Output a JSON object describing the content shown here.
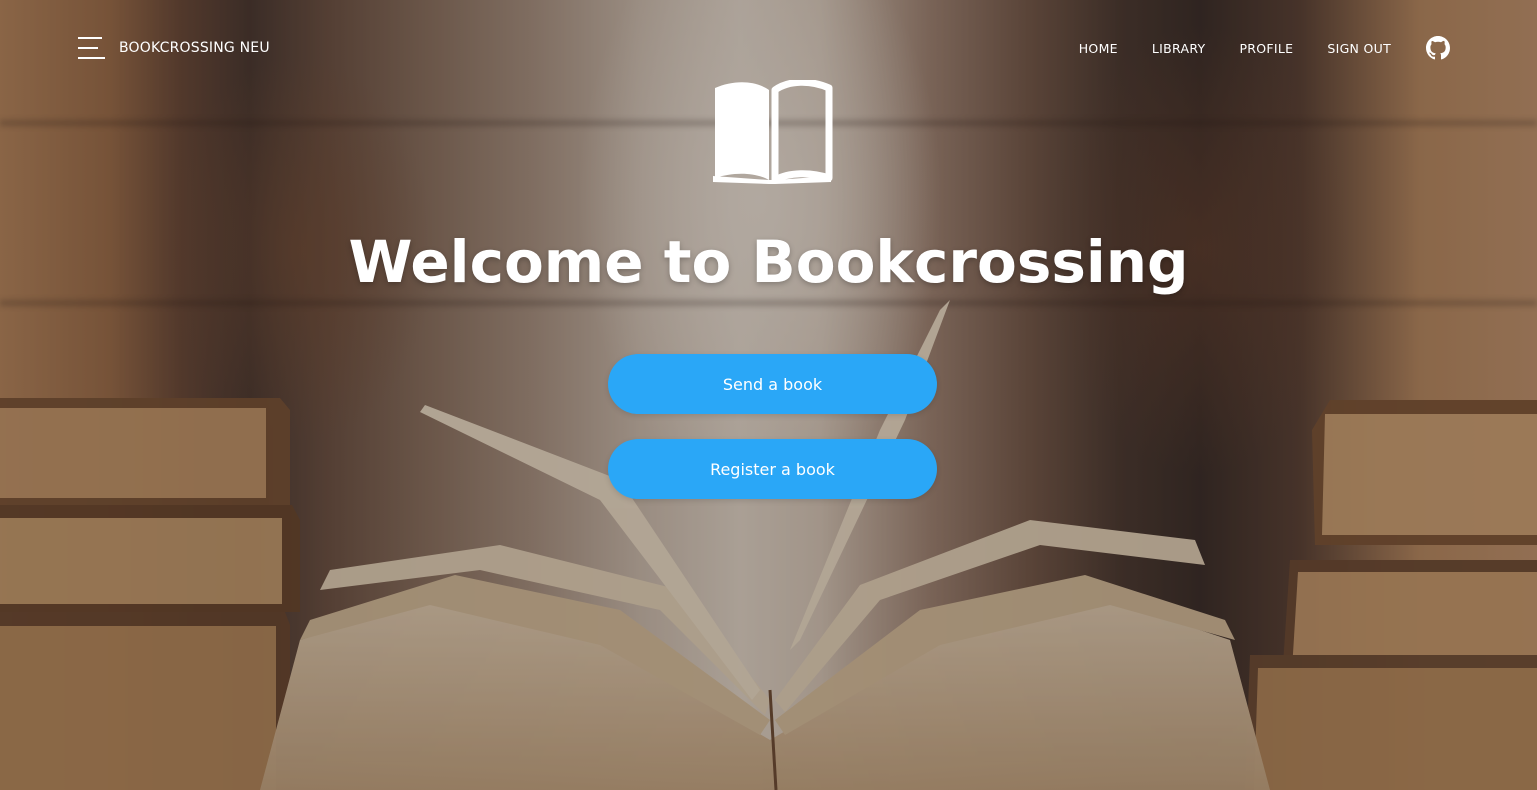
{
  "navbar": {
    "menu_icon": "hamburger-menu-icon",
    "brand": "BOOKCROSSING NEU",
    "links": [
      {
        "label": "HOME"
      },
      {
        "label": "LIBRARY"
      },
      {
        "label": "PROFILE"
      },
      {
        "label": "SIGN OUT"
      }
    ],
    "repo_icon": "github-icon"
  },
  "hero": {
    "icon": "open-book-icon",
    "title": "Welcome to Bookcrossing",
    "buttons": {
      "send": "Send a book",
      "register": "Register a book"
    }
  },
  "colors": {
    "accent": "#2aa7f7",
    "text": "#ffffff"
  }
}
